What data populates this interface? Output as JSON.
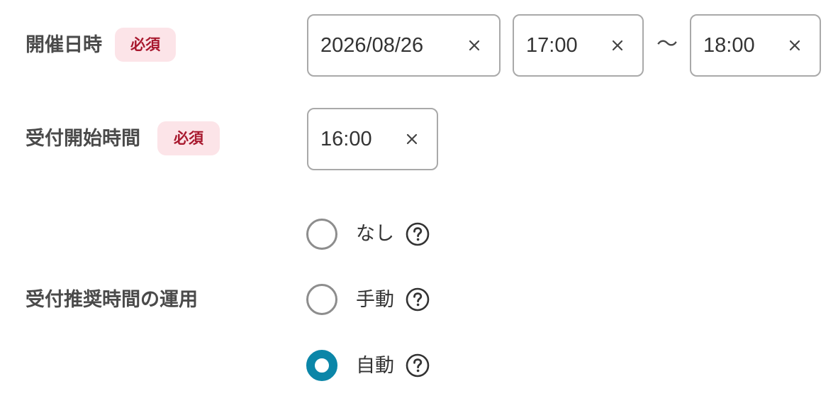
{
  "event_datetime": {
    "label": "開催日時",
    "required_badge": "必須",
    "date_value": "2026/08/26",
    "start_time_value": "17:00",
    "range_separator": "〜",
    "end_time_value": "18:00"
  },
  "reception_start": {
    "label": "受付開始時間",
    "required_badge": "必須",
    "time_value": "16:00"
  },
  "recommended_reception": {
    "label": "受付推奨時間の運用",
    "options": [
      {
        "label": "なし",
        "checked": false
      },
      {
        "label": "手動",
        "checked": false
      },
      {
        "label": "自動",
        "checked": true
      }
    ]
  },
  "colors": {
    "accent": "#0b86a8",
    "required_badge_bg": "#fce4e8",
    "required_badge_text": "#a8182e",
    "field_border": "#a9a9a9"
  },
  "icons": {
    "clear": "close-icon",
    "help": "question-circle-icon"
  }
}
